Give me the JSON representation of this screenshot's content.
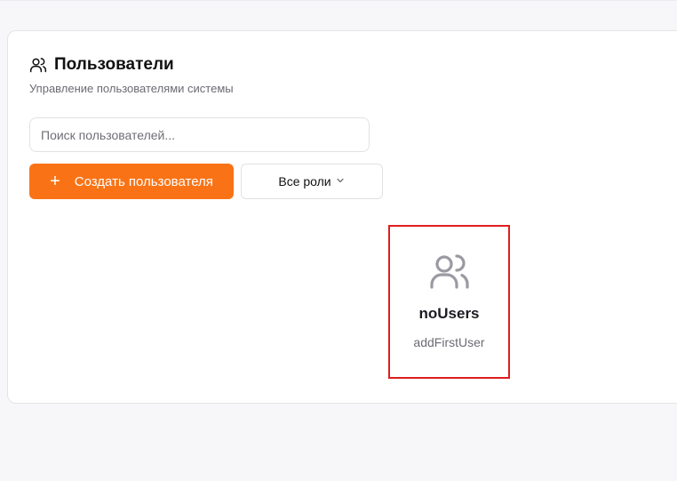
{
  "header": {
    "title": "Пользователи",
    "subtitle": "Управление пользователями системы",
    "icon": "users-icon"
  },
  "search": {
    "placeholder": "Поиск пользователей...",
    "value": ""
  },
  "toolbar": {
    "create_label": "Создать пользователя",
    "create_icon": "plus-icon",
    "role_filter": {
      "selected": "Все роли",
      "icon": "chevron-down-icon"
    }
  },
  "empty_state": {
    "icon": "users-icon",
    "title": "noUsers",
    "subtitle": "addFirstUser",
    "highlight_color": "#e11d1d"
  },
  "colors": {
    "accent": "#f97316",
    "background": "#f7f7f9",
    "card": "#ffffff"
  }
}
